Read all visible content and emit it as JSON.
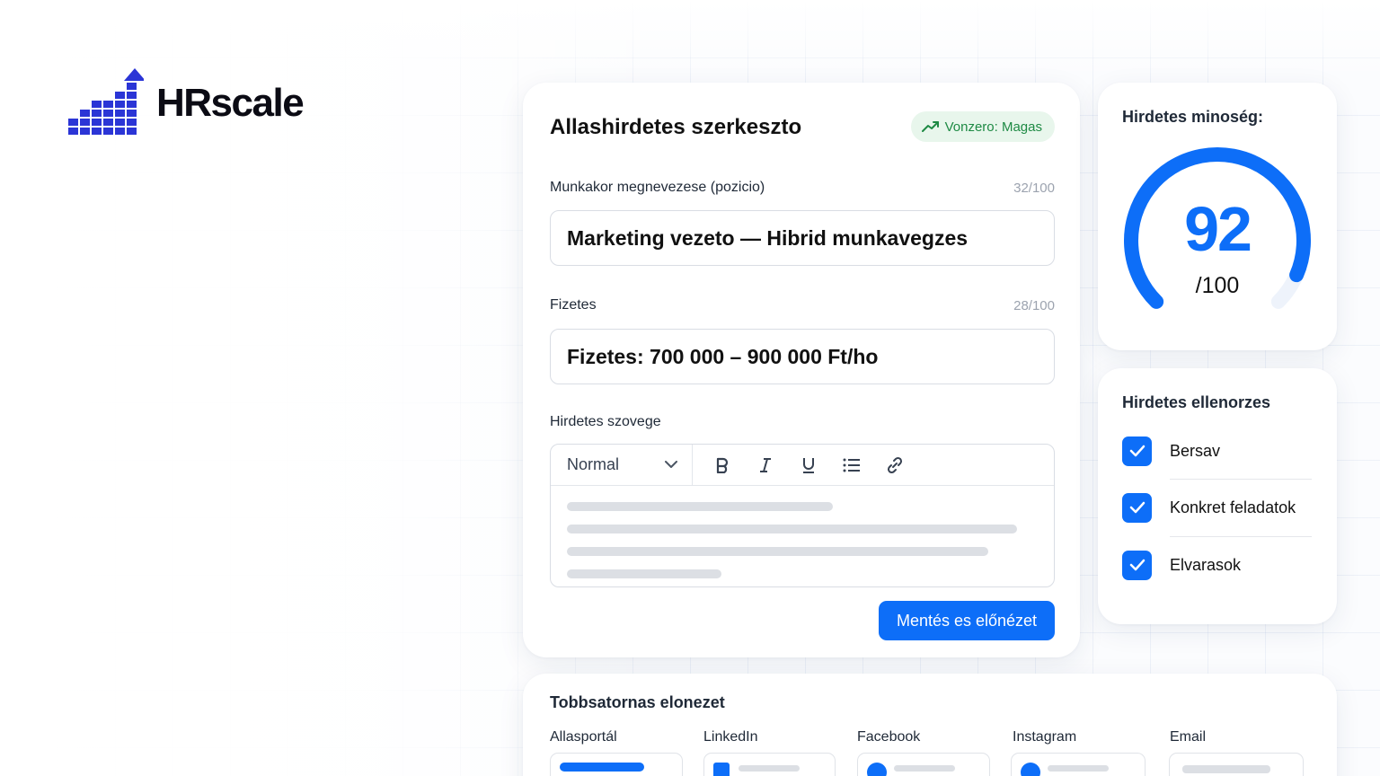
{
  "brand": {
    "name": "HRscale",
    "color": "#2b35d6"
  },
  "editor": {
    "title": "Allashirdetes szerkeszto",
    "badge": "Vonzero: Magas",
    "fields": [
      {
        "label": "Munkakor megnevezese (pozicio)",
        "count": "32/100",
        "value": "Marketing vezeto — Hibrid munkavegzes"
      },
      {
        "label": "Fizetes",
        "count": "28/100",
        "value": "Fizetes: 700 000 – 900 000 Ft/ho"
      }
    ],
    "body_label": "Hirdetes szovege",
    "format_select": "Normal",
    "toolbar": [
      "bold-icon",
      "italic-icon",
      "underline-icon",
      "list-icon",
      "link-icon"
    ],
    "save_label": "Mentés es előnézet"
  },
  "quality": {
    "title": "Hirdetes minoség:",
    "score": "92",
    "max": "/100",
    "score_fraction": 0.92
  },
  "check": {
    "title": "Hirdetes ellenorzes",
    "items": [
      {
        "label": "Bersav",
        "checked": true
      },
      {
        "label": "Konkret feladatok",
        "checked": true
      },
      {
        "label": "Elvarasok",
        "checked": true
      }
    ]
  },
  "preview": {
    "title": "Tobbsatornas elonezet",
    "channels": [
      "Allasportál",
      "LinkedIn",
      "Facebook",
      "Instagram",
      "Email"
    ]
  },
  "colors": {
    "accent": "#0d6ef8",
    "badge_bg": "#e8f6ec",
    "badge_text": "#1e8a44"
  }
}
